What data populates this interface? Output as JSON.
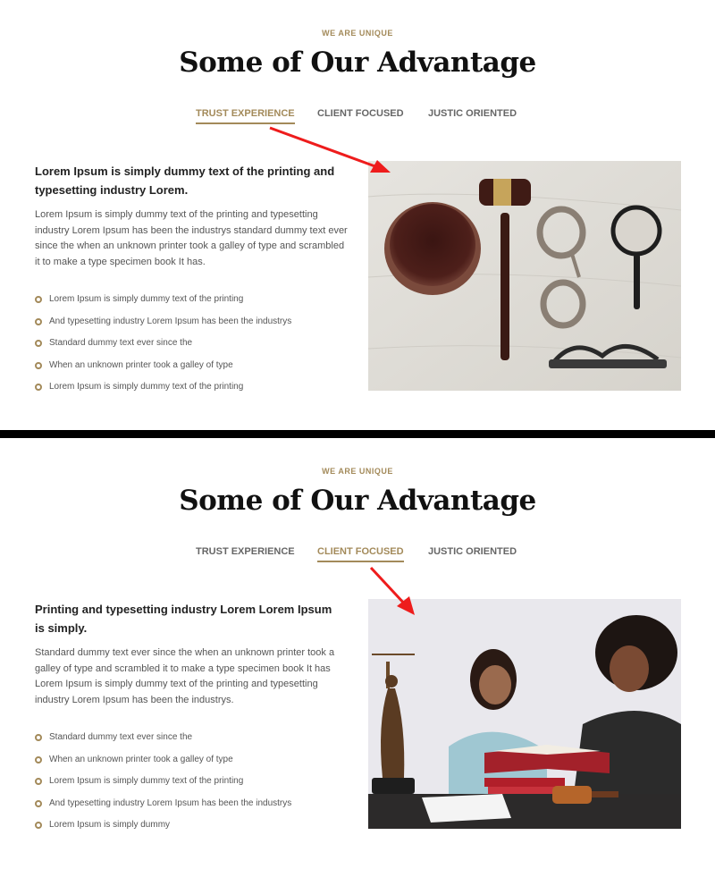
{
  "panels": [
    {
      "eyebrow": "WE ARE UNIQUE",
      "heading": "Some of Our Advantage",
      "tabs": [
        {
          "label": "TRUST EXPERIENCE",
          "active": true
        },
        {
          "label": "CLIENT FOCUSED",
          "active": false
        },
        {
          "label": "JUSTIC ORIENTED",
          "active": false
        }
      ],
      "content": {
        "title": "Lorem Ipsum is simply dummy text of the printing and typesetting industry Lorem.",
        "body": "Lorem Ipsum is simply dummy text of the printing and typesetting industry Lorem Ipsum has been the industrys standard dummy text ever since the when an unknown printer took a galley of type and scrambled it to make a type specimen book It has.",
        "features": [
          "Lorem Ipsum is simply dummy text of the printing",
          "And typesetting industry Lorem Ipsum has been the industrys",
          "Standard dummy text ever since the",
          "When an unknown printer took a galley of type",
          "Lorem Ipsum is simply dummy text of the printing"
        ]
      }
    },
    {
      "eyebrow": "WE ARE UNIQUE",
      "heading": "Some of Our Advantage",
      "tabs": [
        {
          "label": "TRUST EXPERIENCE",
          "active": false
        },
        {
          "label": "CLIENT FOCUSED",
          "active": true
        },
        {
          "label": "JUSTIC ORIENTED",
          "active": false
        }
      ],
      "content": {
        "title": "Printing and typesetting industry Lorem Lorem Ipsum is simply.",
        "body": "Standard dummy text ever since the when an unknown printer took a galley of type and scrambled it to make a type specimen book It has Lorem Ipsum is simply dummy text of the printing and typesetting industry Lorem Ipsum has been the industrys.",
        "features": [
          "Standard dummy text ever since the",
          "When an unknown printer took a galley of type",
          "Lorem Ipsum is simply dummy text of the printing",
          "And typesetting industry Lorem Ipsum has been the industrys",
          "Lorem Ipsum is simply dummy"
        ]
      }
    }
  ],
  "colors": {
    "accent": "#a38a5a",
    "annotation_arrow": "#ee1c1c",
    "divider": "#000000"
  }
}
